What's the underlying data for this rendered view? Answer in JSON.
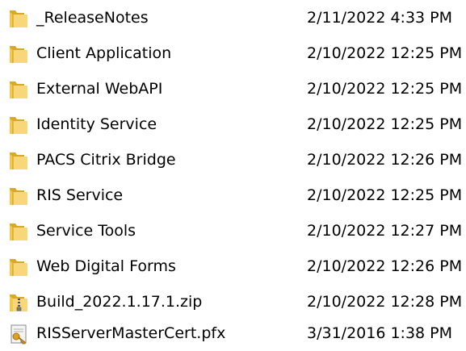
{
  "files": [
    {
      "name": "_ReleaseNotes",
      "modified": "2/11/2022 4:33 PM",
      "icon": "folder-icon"
    },
    {
      "name": "Client Application",
      "modified": "2/10/2022 12:25 PM",
      "icon": "folder-icon"
    },
    {
      "name": "External WebAPI",
      "modified": "2/10/2022 12:25 PM",
      "icon": "folder-icon"
    },
    {
      "name": "Identity Service",
      "modified": "2/10/2022 12:25 PM",
      "icon": "folder-icon"
    },
    {
      "name": "PACS Citrix Bridge",
      "modified": "2/10/2022 12:26 PM",
      "icon": "folder-icon"
    },
    {
      "name": "RIS Service",
      "modified": "2/10/2022 12:25 PM",
      "icon": "folder-icon"
    },
    {
      "name": "Service Tools",
      "modified": "2/10/2022 12:27 PM",
      "icon": "folder-icon"
    },
    {
      "name": "Web Digital Forms",
      "modified": "2/10/2022 12:26 PM",
      "icon": "folder-icon"
    },
    {
      "name": "Build_2022.1.17.1.zip",
      "modified": "2/10/2022 12:28 PM",
      "icon": "zip-folder-icon"
    },
    {
      "name": "RISServerMasterCert.pfx",
      "modified": "3/31/2016 1:38 PM",
      "icon": "certificate-file-icon"
    }
  ],
  "colors": {
    "folder_light": "#f7d777",
    "folder_dark": "#d9a72a",
    "background": "#ffffff",
    "text": "#000000"
  }
}
